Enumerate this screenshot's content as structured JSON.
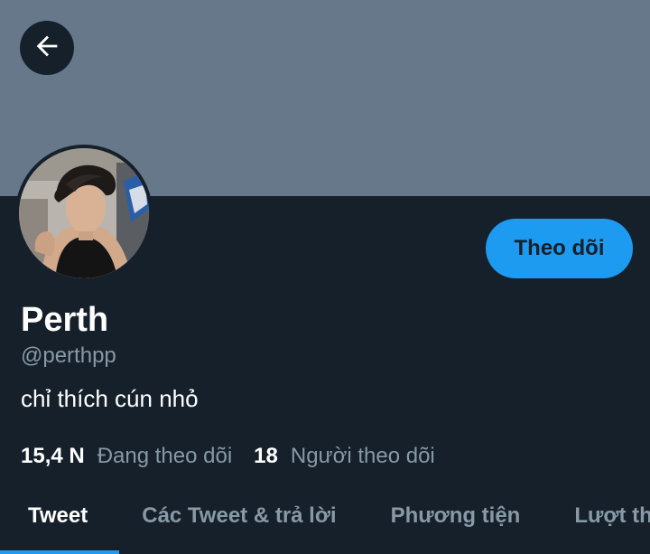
{
  "header": {
    "back_icon": "arrow-left-icon",
    "banner_color": "#66788a"
  },
  "profile": {
    "avatar": "avatar-photo",
    "name": "Perth",
    "handle": "@perthpp",
    "bio": "chỉ thích cún nhỏ",
    "follow_label": "Theo dõi"
  },
  "stats": {
    "following_count": "15,4 N",
    "following_label": "Đang theo dõi",
    "followers_count": "18",
    "followers_label": "Người theo dõi"
  },
  "tabs": [
    {
      "label": "Tweet",
      "active": true
    },
    {
      "label": "Các Tweet & trả lời",
      "active": false
    },
    {
      "label": "Phương tiện",
      "active": false
    },
    {
      "label": "Lượt thích",
      "active": false
    }
  ],
  "colors": {
    "background": "#15202b",
    "accent": "#1d9bf0",
    "secondary_text": "#8899a6"
  }
}
